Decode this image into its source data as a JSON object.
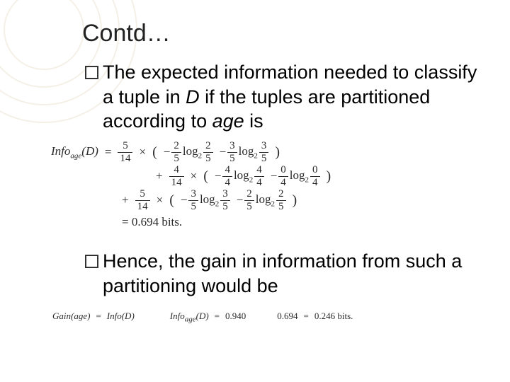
{
  "title": "Contd…",
  "bullets": {
    "b1": {
      "prefix": "The",
      "rest1": " expected information needed to classify a tuple in ",
      "D": "D",
      "rest2": " if the tuples are partitioned according to ",
      "age": "age",
      "rest3": " is"
    },
    "b2": {
      "prefix": "Hence,",
      "rest": " the gain in information from such a partitioning would be"
    }
  },
  "formula1": {
    "lhs": "Info",
    "lhs_sub": "age",
    "lhs_arg": "(D)",
    "eq": "=",
    "terms": [
      {
        "outer_num": "5",
        "outer_den": "14",
        "times": "×",
        "inner": [
          {
            "sign": "−",
            "num": "2",
            "den": "5",
            "lognum": "2",
            "logden": "5"
          },
          {
            "sign": "−",
            "num": "3",
            "den": "5",
            "lognum": "3",
            "logden": "5"
          }
        ]
      },
      {
        "plus": "+",
        "outer_num": "4",
        "outer_den": "14",
        "times": "×",
        "inner": [
          {
            "sign": "−",
            "num": "4",
            "den": "4",
            "lognum": "4",
            "logden": "4"
          },
          {
            "sign": "−",
            "num": "0",
            "den": "4",
            "lognum": "0",
            "logden": "4"
          }
        ]
      },
      {
        "plus": "+",
        "outer_num": "5",
        "outer_den": "14",
        "times": "×",
        "inner": [
          {
            "sign": "−",
            "num": "3",
            "den": "5",
            "lognum": "3",
            "logden": "5"
          },
          {
            "sign": "−",
            "num": "2",
            "den": "5",
            "lognum": "2",
            "logden": "5"
          }
        ]
      }
    ],
    "result": "= 0.694 bits."
  },
  "formula2": {
    "gain_lhs": "Gain(age)",
    "eq1": "=",
    "info_lhs": "Info(D)",
    "minus_implicit": "",
    "infoage_lhs": "Info",
    "infoage_sub": "age",
    "infoage_arg": "(D)",
    "eq2": "=",
    "v1": "0.940",
    "v2": "0.694",
    "eq3": "=",
    "result": "0.246 bits."
  },
  "log_label": "log",
  "log_base": "2"
}
